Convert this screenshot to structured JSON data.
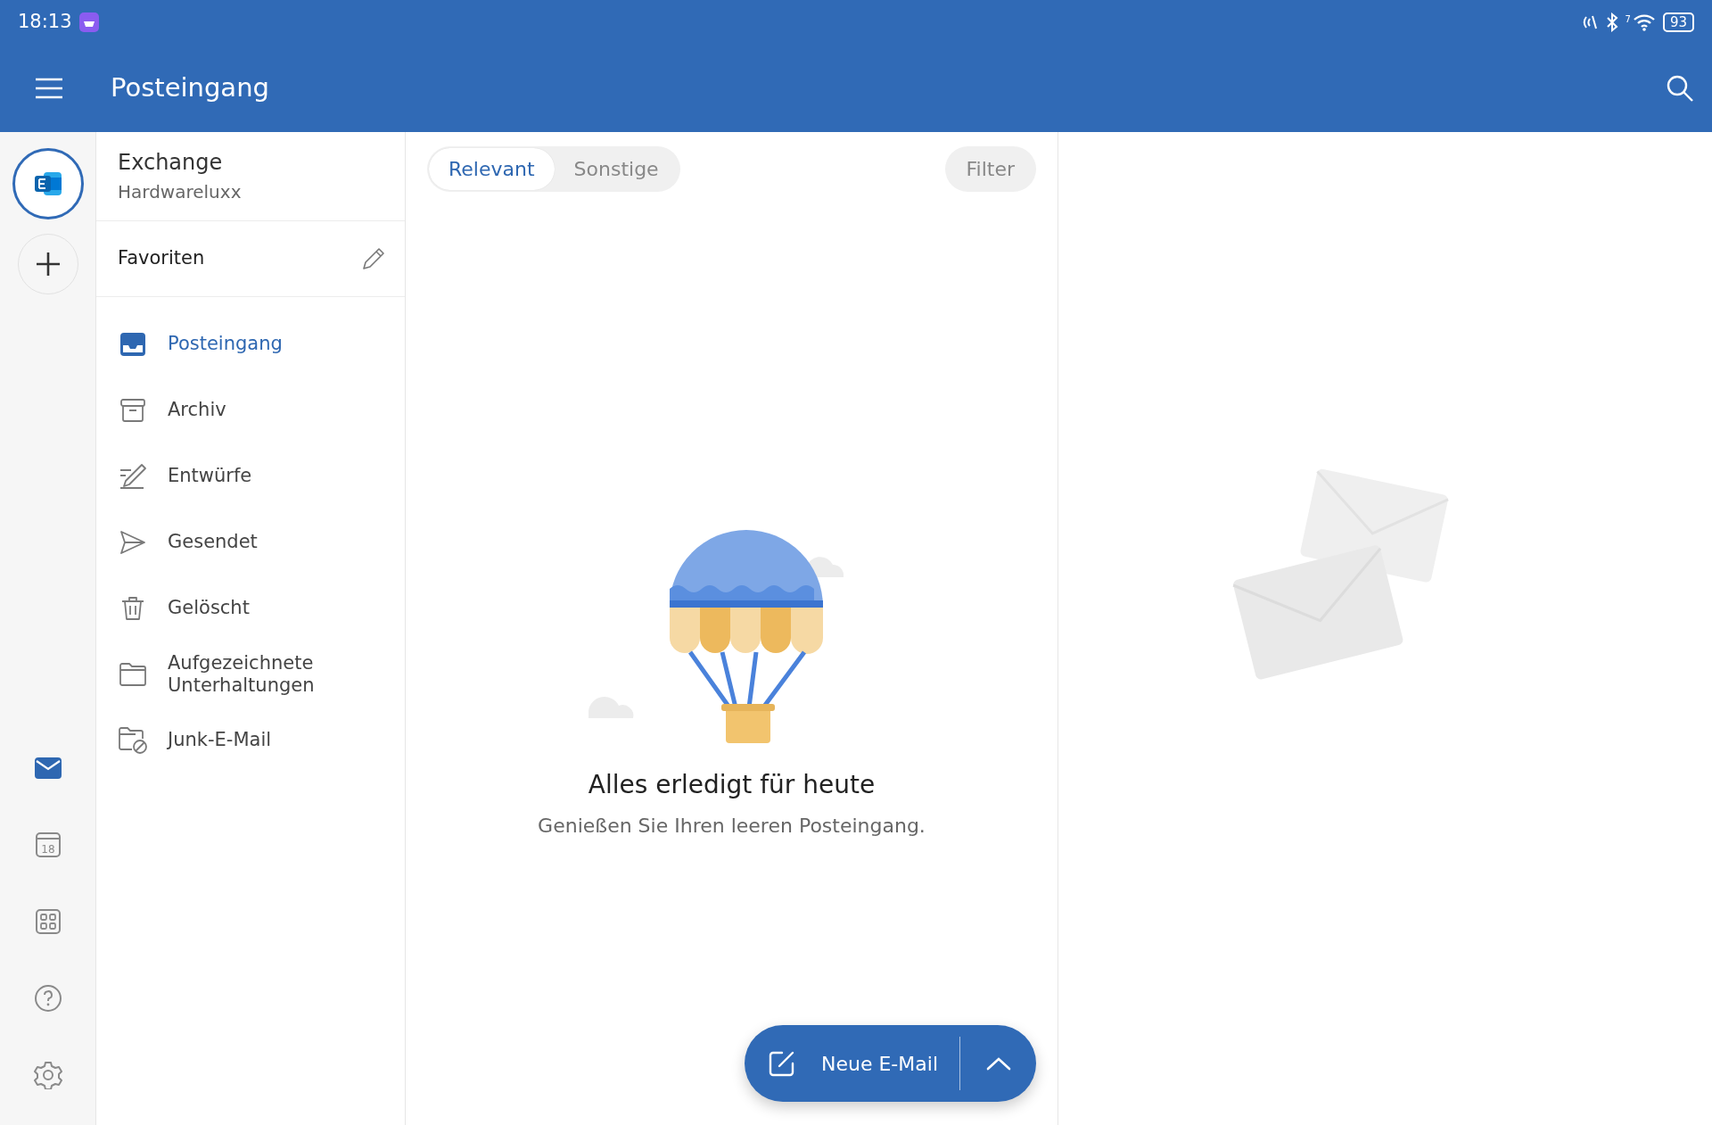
{
  "status_bar": {
    "time": "18:13",
    "wifi_badge": "7",
    "battery": "93"
  },
  "header": {
    "title": "Posteingang"
  },
  "account": {
    "name": "Exchange",
    "org": "Hardwareluxx"
  },
  "favorites": {
    "label": "Favoriten"
  },
  "folders": [
    {
      "label": "Posteingang",
      "kind": "inbox",
      "selected": true
    },
    {
      "label": "Archiv",
      "kind": "archive",
      "selected": false
    },
    {
      "label": "Entwürfe",
      "kind": "drafts",
      "selected": false
    },
    {
      "label": "Gesendet",
      "kind": "sent",
      "selected": false
    },
    {
      "label": "Gelöscht",
      "kind": "trash",
      "selected": false
    },
    {
      "label": "Aufgezeichnete Unterhaltungen",
      "kind": "folder",
      "selected": false
    },
    {
      "label": "Junk-E-Mail",
      "kind": "junk",
      "selected": false
    }
  ],
  "rail": [
    {
      "kind": "mail",
      "selected": true
    },
    {
      "kind": "calendar",
      "selected": false,
      "label": "18"
    },
    {
      "kind": "apps",
      "selected": false
    },
    {
      "kind": "help",
      "selected": false
    },
    {
      "kind": "settings",
      "selected": false
    }
  ],
  "tabs": [
    {
      "label": "Relevant",
      "selected": true
    },
    {
      "label": "Sonstige",
      "selected": false
    }
  ],
  "filter": {
    "label": "Filter"
  },
  "empty_state": {
    "title": "Alles erledigt für heute",
    "message": "Genießen Sie Ihren leeren Posteingang."
  },
  "compose": {
    "label": "Neue E-Mail"
  }
}
